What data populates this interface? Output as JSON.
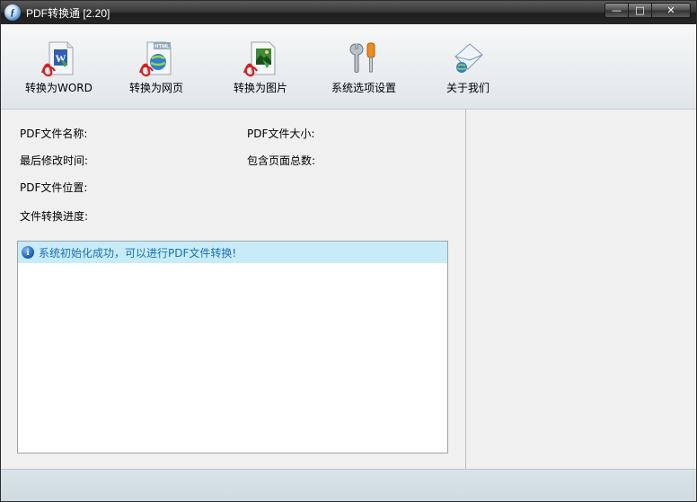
{
  "window": {
    "title": "PDF转换通 [2.20]",
    "app_icon_glyph": "ƒ",
    "controls": {
      "minimize": "—",
      "maximize": "□",
      "close": "✕"
    }
  },
  "toolbar": {
    "items": [
      {
        "label": "转换为WORD",
        "icon": "pdf-to-word-icon"
      },
      {
        "label": "转换为网页",
        "icon": "pdf-to-html-icon"
      },
      {
        "label": "转换为图片",
        "icon": "pdf-to-image-icon"
      },
      {
        "label": "系统选项设置",
        "icon": "settings-tools-icon"
      },
      {
        "label": "关于我们",
        "icon": "about-mail-icon"
      }
    ],
    "html_badge": "HTML"
  },
  "info": {
    "file_name_label": "PDF文件名称:",
    "file_size_label": "PDF文件大小:",
    "modified_label": "最后修改时间:",
    "page_count_label": "包含页面总数:",
    "location_label": "PDF文件位置:",
    "progress_label": "文件转换进度:"
  },
  "log": {
    "icon": "info-icon",
    "icon_glyph": "i",
    "message": "系统初始化成功，可以进行PDF文件转换!"
  },
  "colors": {
    "log_highlight": "#c7ecf8",
    "log_text": "#1a6fb3",
    "pdf_red": "#d42020"
  }
}
